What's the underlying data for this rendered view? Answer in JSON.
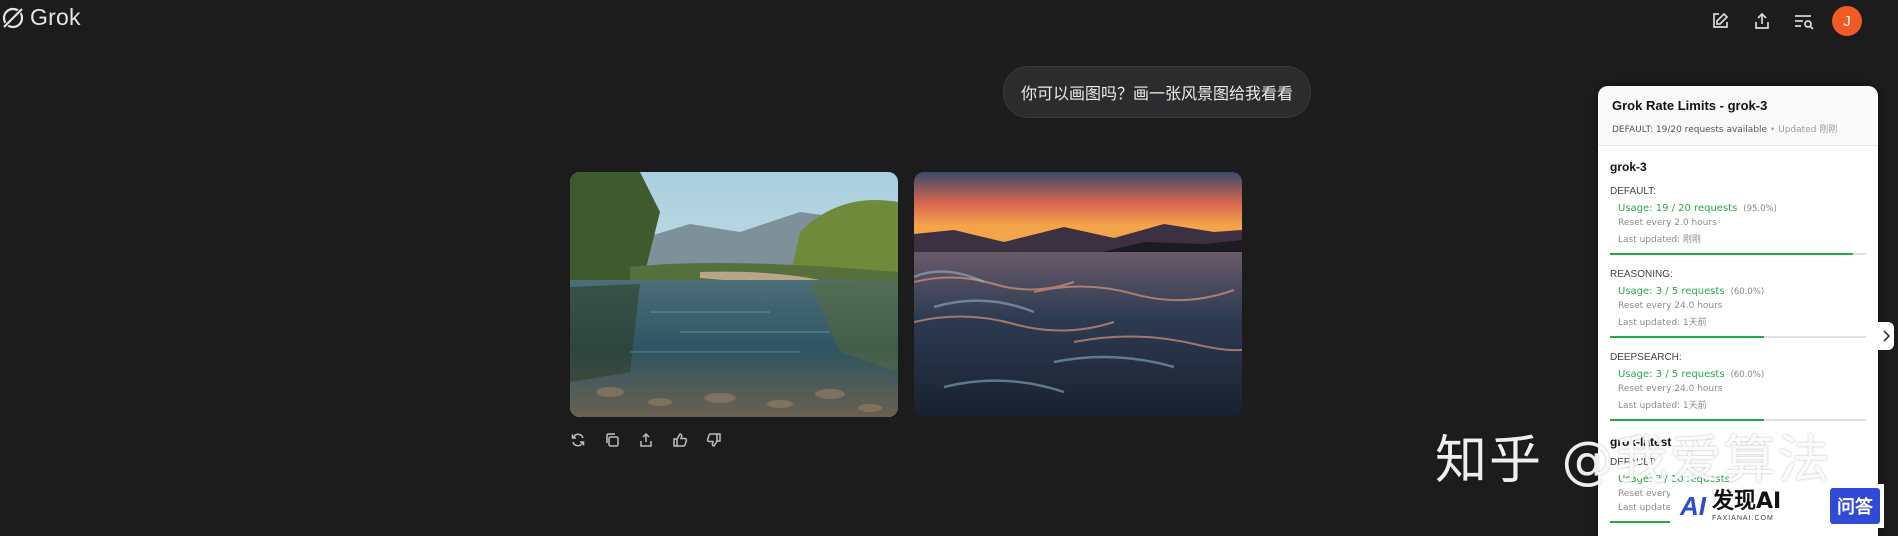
{
  "app": {
    "name": "Grok"
  },
  "header": {
    "icons": [
      "edit-icon",
      "share-icon",
      "history-search-icon"
    ],
    "avatar_letter": "J",
    "avatar_color": "#f15a24"
  },
  "conversation": {
    "user_message": "你可以画图吗？画一张风景图给我看看",
    "message_actions": [
      "regenerate-icon",
      "copy-icon",
      "share-icon",
      "thumbs-up-icon",
      "thumbs-down-icon"
    ]
  },
  "rate_limits": {
    "title": "Grok Rate Limits - grok-3",
    "summary": "DEFAULT: 19/20 requests available",
    "summary_updated": " • Updated 刚刚",
    "models": [
      {
        "name": "grok-3",
        "categories": [
          {
            "label": "DEFAULT:",
            "usage": "Usage: 19 / 20 requests",
            "pct": "(95.0%)",
            "reset": "Reset every 2.0 hours",
            "updated": "Last updated: 刚刚",
            "fraction": 0.95
          },
          {
            "label": "REASONING:",
            "usage": "Usage: 3 / 5 requests",
            "pct": "(60.0%)",
            "reset": "Reset every 24.0 hours",
            "updated": "Last updated: 1天前",
            "fraction": 0.6
          },
          {
            "label": "DEEPSEARCH:",
            "usage": "Usage: 3 / 5 requests",
            "pct": "(60.0%)",
            "reset": "Reset every 24.0 hours",
            "updated": "Last updated: 1天前",
            "fraction": 0.6
          }
        ]
      },
      {
        "name": "grok-latest",
        "categories": [
          {
            "label": "DEFAULT:",
            "usage": "Usage: ? / 10 requests",
            "reset": "Reset every ? hours",
            "updated": "Last updated:",
            "fraction": 0.4
          }
        ]
      }
    ],
    "accent_color": "#24a84a"
  },
  "watermark": {
    "text": "知乎 @我爱算法",
    "badge_mark": "AI",
    "badge_name": "发现AI",
    "badge_domain": "FAXIANAI.COM",
    "badge_tag": "问答"
  }
}
